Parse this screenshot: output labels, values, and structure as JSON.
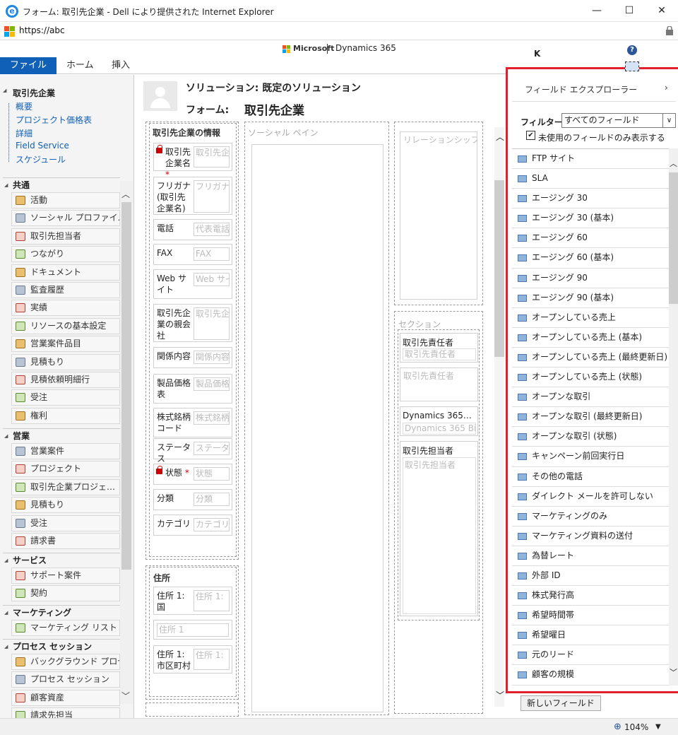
{
  "window": {
    "title": "フォーム: 取引先企業 - Dell により提供された Internet Explorer",
    "url": "https://abc",
    "buttons": [
      "—",
      "☐",
      "✕"
    ]
  },
  "header": {
    "brand_ms": "Microsoft",
    "brand_product": "Dynamics 365",
    "user_initial": "K",
    "help": "?"
  },
  "ribbon": {
    "tabs": [
      "ファイル",
      "ホーム",
      "挿入"
    ]
  },
  "leftnav": {
    "entity": "取引先企業",
    "sublinks": [
      "概要",
      "プロジェクト価格表",
      "詳細",
      "Field Service",
      "スケジュール"
    ],
    "groups": [
      {
        "title": "共通",
        "items": [
          "活動",
          "ソーシャル プロファイル",
          "取引先担当者",
          "つながり",
          "ドキュメント",
          "監査履歴",
          "実績",
          "リソースの基本設定",
          "営業案件品目",
          "見積もり",
          "見積依頼明細行",
          "受注",
          "権利"
        ]
      },
      {
        "title": "営業",
        "items": [
          "営業案件",
          "プロジェクト",
          "取引先企業プロジェ…",
          "見積もり",
          "受注",
          "請求書"
        ]
      },
      {
        "title": "サービス",
        "items": [
          "サポート案件",
          "契約"
        ]
      },
      {
        "title": "マーケティング",
        "items": [
          "マーケティング リスト"
        ]
      },
      {
        "title": "プロセス セッション",
        "items": [
          "バックグラウンド プロセス",
          "プロセス セッション",
          "顧客資産",
          "請求先担当"
        ]
      }
    ]
  },
  "form": {
    "solution": "ソリューション: 既定のソリューション",
    "form_label": "フォーム:",
    "form_name": "取引先企業",
    "section_info": "取引先企業の情報",
    "section_social": "ソーシャル ペイン",
    "section_relationship": "リレーションシップ アシ",
    "section_generic": "セクション",
    "section_address": "住所",
    "fields": [
      {
        "label": "取引先企業名",
        "placeholder": "取引先企",
        "required": true,
        "locked": true
      },
      {
        "label": "フリガナ (取引先企業名)",
        "placeholder": "フリガナ (",
        "required": false,
        "locked": false
      },
      {
        "label": "電話",
        "placeholder": "代表電話",
        "required": false,
        "locked": false
      },
      {
        "label": "FAX",
        "placeholder": "FAX",
        "required": false,
        "locked": false
      },
      {
        "label": "Web サイト",
        "placeholder": "Web サイ",
        "required": false,
        "locked": false
      },
      {
        "label": "取引先企業の親会社",
        "placeholder": "取引先企",
        "required": false,
        "locked": false
      },
      {
        "label": "関係内容",
        "placeholder": "関係内容",
        "required": false,
        "locked": false
      },
      {
        "label": "製品価格表",
        "placeholder": "製品価格",
        "required": false,
        "locked": false
      },
      {
        "label": "株式銘柄コード",
        "placeholder": "株式銘柄",
        "required": false,
        "locked": false
      },
      {
        "label": "ステータス",
        "placeholder": "ステータス",
        "required": false,
        "locked": false
      },
      {
        "label": "状態",
        "placeholder": "状態",
        "required": true,
        "locked": true
      },
      {
        "label": "分類",
        "placeholder": "分類",
        "required": false,
        "locked": false
      },
      {
        "label": "カテゴリ",
        "placeholder": "カテゴリ",
        "required": false,
        "locked": false
      }
    ],
    "address_fields": [
      {
        "label": "住所 1: 国",
        "placeholder": "住所 1:"
      },
      {
        "label": "",
        "placeholder": "住所 1"
      },
      {
        "label": "住所 1: 市区町村",
        "placeholder": "住所 1:"
      }
    ],
    "right_col": {
      "owner_label": "取引先責任者",
      "owner_placeholder": "取引先責任者",
      "owner_placeholder2": "取引先責任者",
      "d365_label": "Dynamics 365…",
      "d365_placeholder": "Dynamics 365 Bi",
      "contact_label": "取引先担当者",
      "contact_placeholder": "取引先担当者"
    }
  },
  "field_explorer": {
    "title": "フィールド エクスプローラー",
    "chevron": "›",
    "filter_label": "フィルター",
    "filter_value": "すべてのフィールド",
    "checkbox_label": "未使用のフィールドのみ表示する",
    "checkbox_checked": true,
    "fields": [
      "FTP サイト",
      "SLA",
      "エージング 30",
      "エージング 30 (基本)",
      "エージング 60",
      "エージング 60 (基本)",
      "エージング 90",
      "エージング 90 (基本)",
      "オープンしている売上",
      "オープンしている売上 (基本)",
      "オープンしている売上 (最終更新日)",
      "オープンしている売上 (状態)",
      "オープンな取引",
      "オープンな取引 (最終更新日)",
      "オープンな取引 (状態)",
      "キャンペーン前回実行日",
      "その他の電話",
      "ダイレクト メールを許可しない",
      "マーケティングのみ",
      "マーケティング資料の送付",
      "為替レート",
      "外部 ID",
      "株式発行高",
      "希望時間帯",
      "希望曜日",
      "元のリード",
      "顧客の規模"
    ],
    "new_field_button": "新しいフィールド"
  },
  "status": {
    "zoom": "104%"
  },
  "colors": {
    "accent": "#1160b7",
    "highlight_border": "#e0202a"
  }
}
